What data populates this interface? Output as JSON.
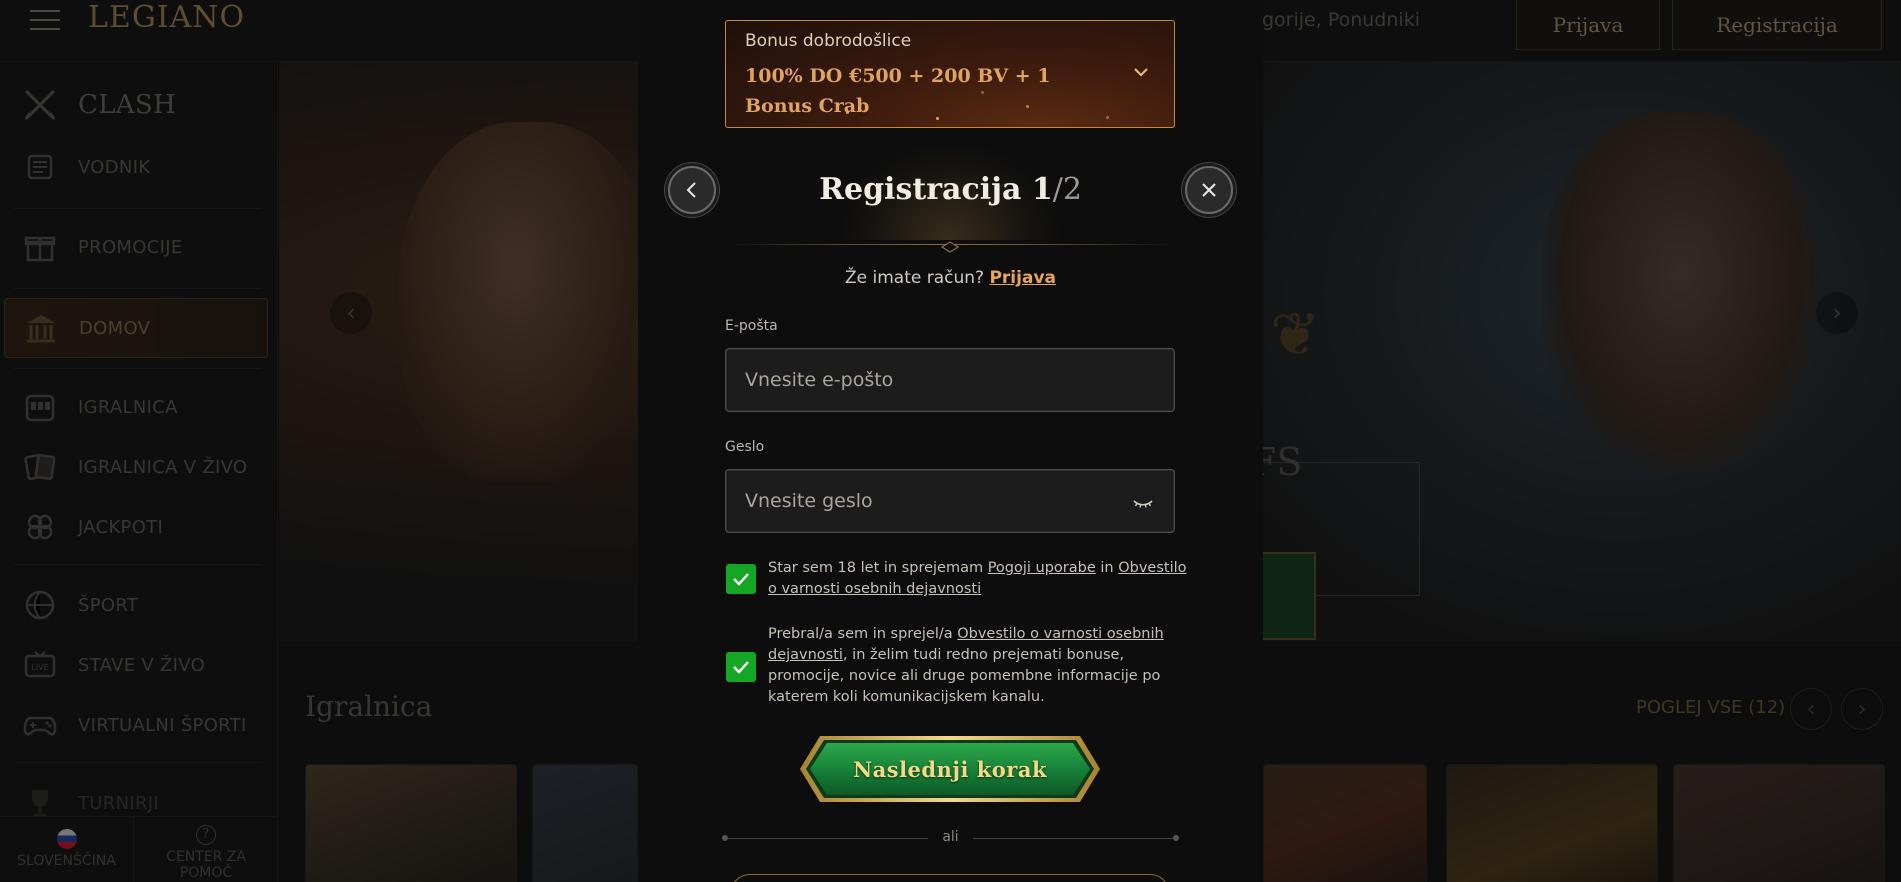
{
  "header": {
    "logo": "LEGIANO",
    "search_placeholder": "gorije, Ponudniki",
    "login_label": "Prijava",
    "register_label": "Registracija"
  },
  "sidebar": {
    "items": [
      {
        "label": "CLASH",
        "icon": "crossed-swords-icon"
      },
      {
        "label": "VODNIK",
        "icon": "scroll-icon"
      },
      {
        "label": "PROMOCIJE",
        "icon": "gift-icon"
      },
      {
        "label": "DOMOV",
        "icon": "temple-icon"
      },
      {
        "label": "IGRALNICA",
        "icon": "slot-machine-icon"
      },
      {
        "label": "IGRALNICA V ŽIVO",
        "icon": "cards-icon"
      },
      {
        "label": "JACKPOTI",
        "icon": "clover-icon"
      },
      {
        "label": "ŠPORT",
        "icon": "ball-icon"
      },
      {
        "label": "STAVE V ŽIVO",
        "icon": "live-tv-icon"
      },
      {
        "label": "VIRTUALNI ŠPORTI",
        "icon": "gamepad-icon"
      },
      {
        "label": "TURNIRJI",
        "icon": "trophy-icon"
      }
    ],
    "active_item": "DOMOV",
    "language": "SLOVENŠČINA",
    "help_line1": "CENTER ZA",
    "help_line2": "POMOČ"
  },
  "background": {
    "hero_text": "FS",
    "section_title": "Igralnica",
    "see_all": "POGLEJ VSE (12)"
  },
  "modal": {
    "bonus_label": "Bonus dobrodošlice",
    "bonus_text": "100% DO €500 + 200 BV + 1 Bonus Crab",
    "title_main": "Registracija 1",
    "title_step": "/2",
    "have_account_text": "Že imate račun?",
    "login_link": "Prijava",
    "email_label": "E-pošta",
    "email_placeholder": "Vnesite e-pošto",
    "password_label": "Geslo",
    "password_placeholder": "Vnesite geslo",
    "consent1_before": "Star sem 18 let in sprejemam ",
    "consent1_link1": "Pogoji uporabe",
    "consent1_mid": " in ",
    "consent1_link2": "Obvestilo o varnosti osebnih dejavnosti",
    "consent1_checked": true,
    "consent2_before": "Prebral/a sem in sprejel/a ",
    "consent2_link": "Obvestilo o varnosti osebnih dejavnosti",
    "consent2_after": ", in želim tudi redno prejemati bonuse, promocije, novice ali druge pomembne informacije po katerem koli komunikacijskem kanalu.",
    "consent2_checked": true,
    "next_button": "Naslednji korak",
    "or_text": "ali"
  },
  "colors": {
    "accent_gold": "#e6a55a",
    "checkbox_green": "#16a626",
    "modal_bg": "#0d0d0d"
  }
}
